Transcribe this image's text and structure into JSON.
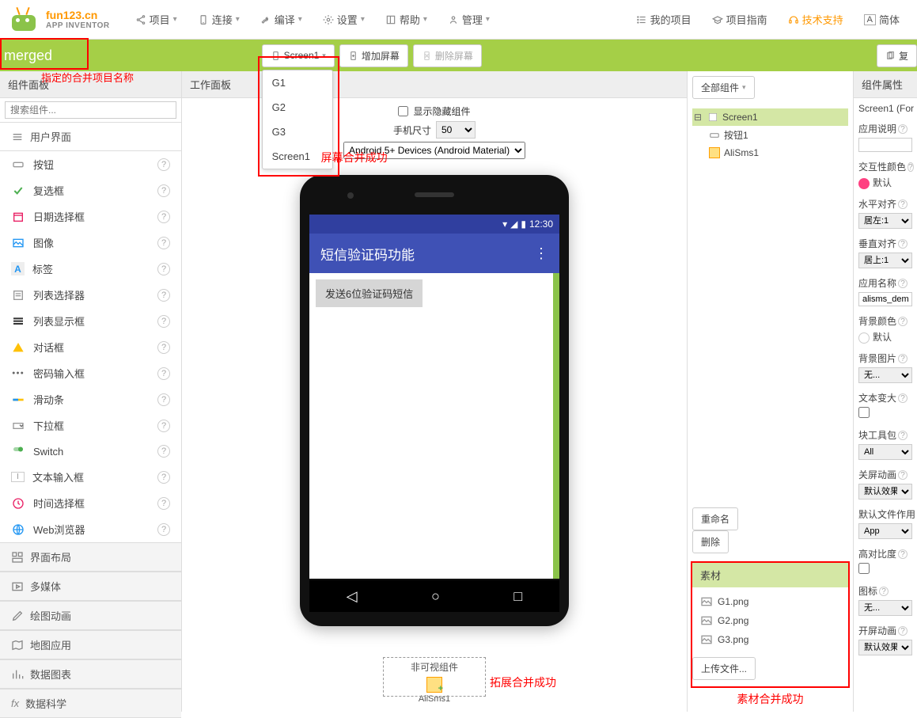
{
  "logo": {
    "site": "fun123.cn",
    "sub": "APP INVENTOR"
  },
  "topmenu": {
    "project": "项目",
    "connect": "连接",
    "build": "编译",
    "settings": "设置",
    "help": "帮助",
    "manage": "管理",
    "myprojects": "我的项目",
    "guide": "项目指南",
    "support": "技术支持",
    "simple": "简体"
  },
  "project_name": "merged",
  "annotations": {
    "name": "指定的合并项目名称",
    "screens": "屏幕合并成功",
    "extension": "拓展合并成功",
    "media": "素材合并成功"
  },
  "screen_btn": "Screen1",
  "screens": [
    "G1",
    "G2",
    "G3",
    "Screen1"
  ],
  "add_screen": "增加屏幕",
  "del_screen": "删除屏幕",
  "right_btn": "复",
  "palette": {
    "header": "组件面板",
    "search_ph": "搜索组件...",
    "cat_ui": "用户界面",
    "cat_layout": "界面布局",
    "cat_media": "多媒体",
    "cat_anim": "绘图动画",
    "cat_maps": "地图应用",
    "cat_charts": "数据图表",
    "cat_data": "数据科学",
    "items": {
      "button": "按钮",
      "checkbox": "复选框",
      "datepicker": "日期选择框",
      "image": "图像",
      "label": "标签",
      "listpicker": "列表选择器",
      "listview": "列表显示框",
      "notifier": "对话框",
      "password": "密码输入框",
      "slider": "滑动条",
      "spinner": "下拉框",
      "switch": "Switch",
      "textbox": "文本输入框",
      "timepicker": "时间选择框",
      "webviewer": "Web浏览器"
    }
  },
  "viewer": {
    "header": "工作面板",
    "show_hidden": "显示隐藏组件",
    "phone_size_label": "手机尺寸",
    "phone_size_val": "50",
    "theme": "Android 5+ Devices (Android Material)",
    "status_time": "12:30",
    "app_title": "短信验证码功能",
    "app_button": "发送6位验证码短信",
    "noncomp_header": "非可视组件",
    "noncomp_item": "AliSms1"
  },
  "components": {
    "all_btn": "全部组件",
    "tree": {
      "screen": "Screen1",
      "button": "按钮1",
      "alisms": "AliSms1"
    },
    "rename": "重命名",
    "delete": "删除",
    "media_header": "素材",
    "media": [
      "G1.png",
      "G2.png",
      "G3.png"
    ],
    "upload": "上传文件..."
  },
  "properties": {
    "header": "组件属性",
    "title": "Screen1 (For",
    "desc_label": "应用说明",
    "accent_label": "交互性颜色",
    "accent_val": "默认",
    "halign_label": "水平对齐",
    "halign_val": "居左:1",
    "valign_label": "垂直对齐",
    "valign_val": "居上:1",
    "appname_label": "应用名称",
    "appname_val": "alisms_demo",
    "bgcolor_label": "背景颜色",
    "bgcolor_val": "默认",
    "bgimage_label": "背景图片",
    "bgimage_val": "无...",
    "bigtext_label": "文本变大",
    "blocks_label": "块工具包",
    "blocks_val": "All",
    "closeanim_label": "关屏动画",
    "closeanim_val": "默认效果",
    "defaultfile_label": "默认文件作用",
    "defaultfile_val": "App",
    "highcontrast_label": "高对比度",
    "icon_label": "图标",
    "icon_val": "无...",
    "openanim_label": "开屏动画",
    "openanim_val": "默认效果"
  }
}
